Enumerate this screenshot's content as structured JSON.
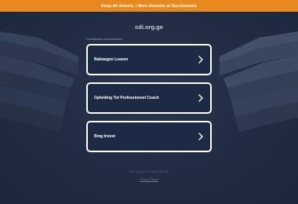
{
  "top_banner": {
    "text": "Koop dit domein. | More domains at See.Domains",
    "bg_color": "#e8891d"
  },
  "domain": "cdi.org.ge",
  "related_label": "Gerelateerde zoekopdrachten",
  "cards": [
    {
      "label": "Bakwagen Leasen",
      "icon": "chevron-right-icon"
    },
    {
      "label": "Opleiding Tot Professioneel Coach",
      "icon": "chevron-right-icon"
    },
    {
      "label": "Bmg Invest",
      "icon": "chevron-right-icon"
    }
  ],
  "footer": {
    "copyright": "2025 Copyright. All Rights Reserved.",
    "privacy": "Privacy Policy"
  },
  "colors": {
    "background": "#1f2a40",
    "card_border": "#ffffff",
    "card_fill": "#1d2a45"
  }
}
